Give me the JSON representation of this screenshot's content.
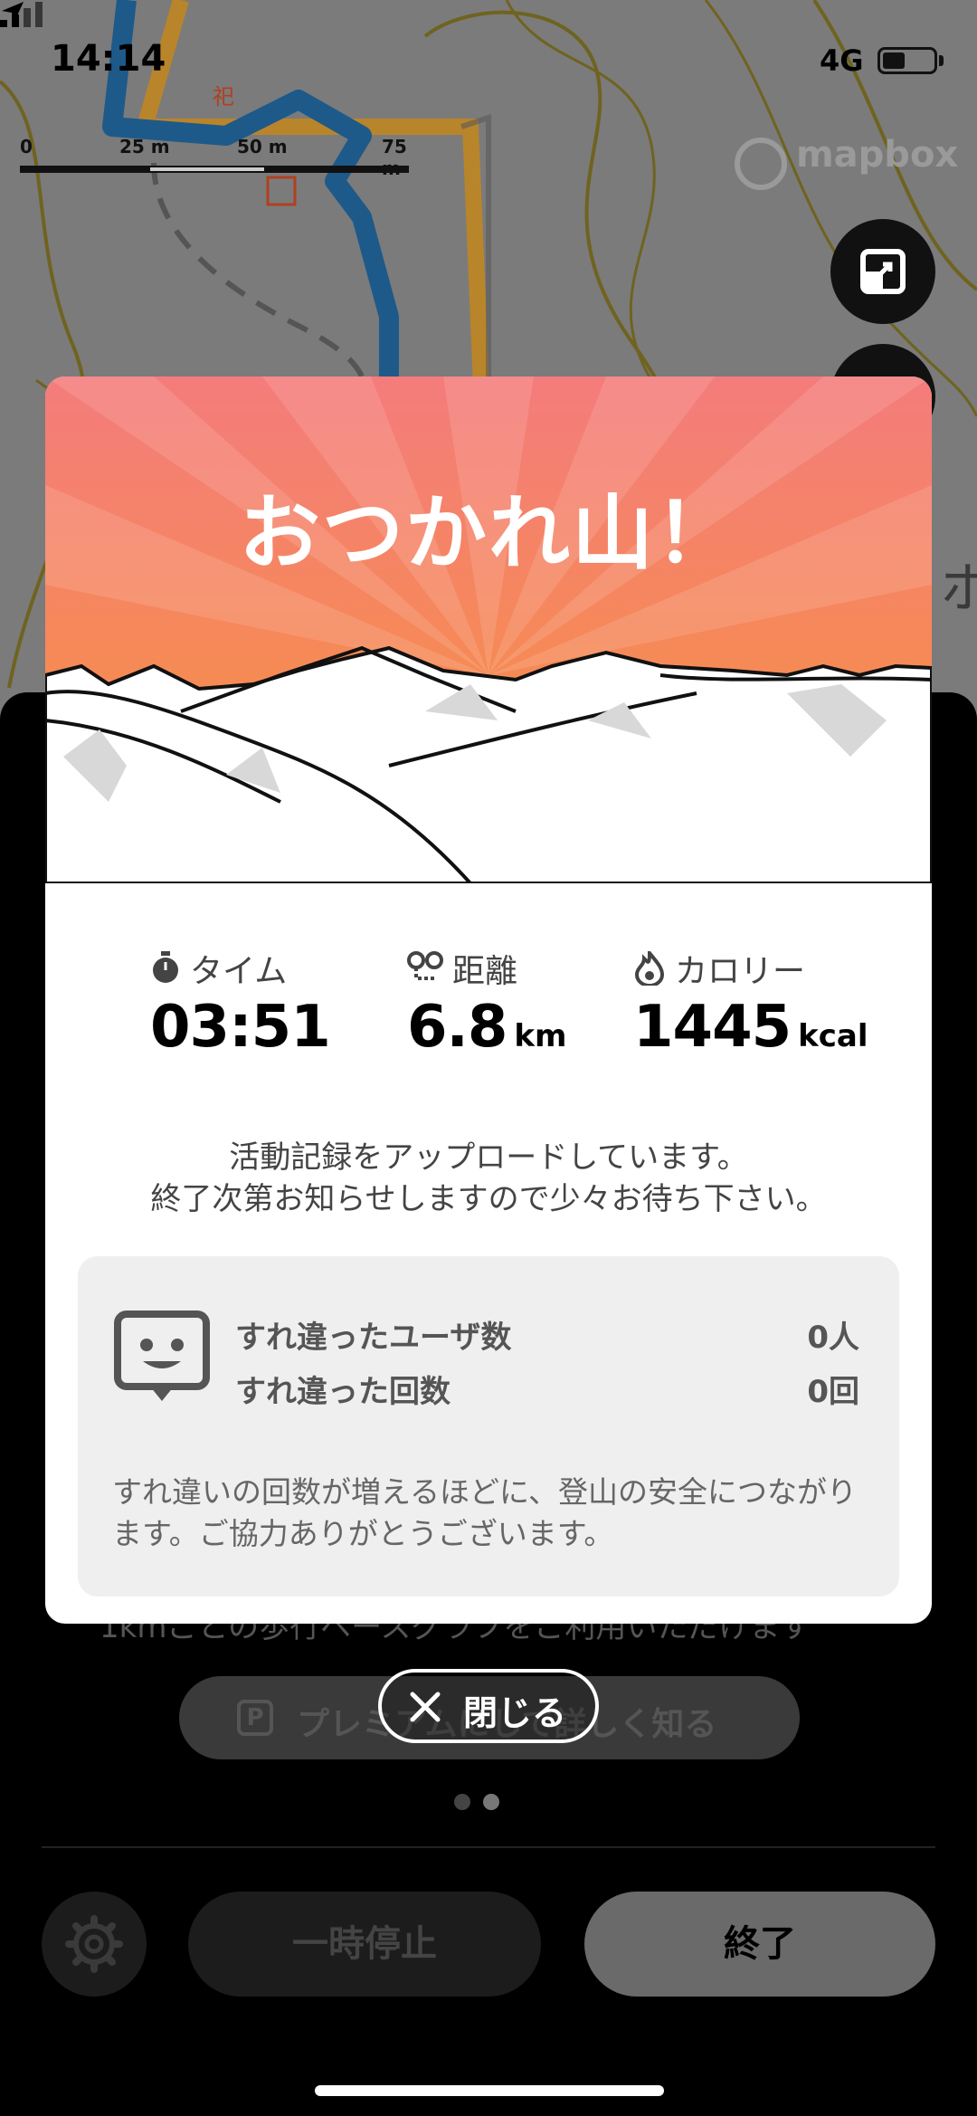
{
  "status_bar": {
    "time": "14:14",
    "network": "4G"
  },
  "map": {
    "scale_labels": [
      "0",
      "25 m",
      "50 m",
      "75 m"
    ],
    "attribution": "mapbox"
  },
  "modal": {
    "title": "おつかれ山！",
    "stats": [
      {
        "label": "タイム",
        "value": "03:51",
        "unit": "",
        "icon": "stopwatch-icon"
      },
      {
        "label": "距離",
        "value": "6.8",
        "unit": "km",
        "icon": "route-icon"
      },
      {
        "label": "カロリー",
        "value": "1445",
        "unit": "kcal",
        "icon": "flame-icon"
      }
    ],
    "upload_message_line1": "活動記録をアップロードしています。",
    "upload_message_line2": "終了次第お知らせしますので少々お待ち下さい。",
    "passing": {
      "users_label": "すれ違ったユーザ数",
      "users_value": "0人",
      "count_label": "すれ違った回数",
      "count_value": "0回",
      "description": "すれ違いの回数が増えるほどに、登山の安全につながります。ご協力ありがとうございます。"
    }
  },
  "close_button": {
    "label": "閉じる"
  },
  "sheet": {
    "note": "1kmごとの歩行ペースグラフをご利用いただけます",
    "premium_icon_letter": "P",
    "premium_label": "プレミアムにして詳しく知る"
  },
  "bottom_bar": {
    "pause_label": "一時停止",
    "end_label": "終了"
  },
  "colors": {
    "hero_top": "#f47c7c",
    "hero_bottom": "#f7943a",
    "route_blue": "#1d5a8a",
    "route_orange": "#b9852a"
  }
}
